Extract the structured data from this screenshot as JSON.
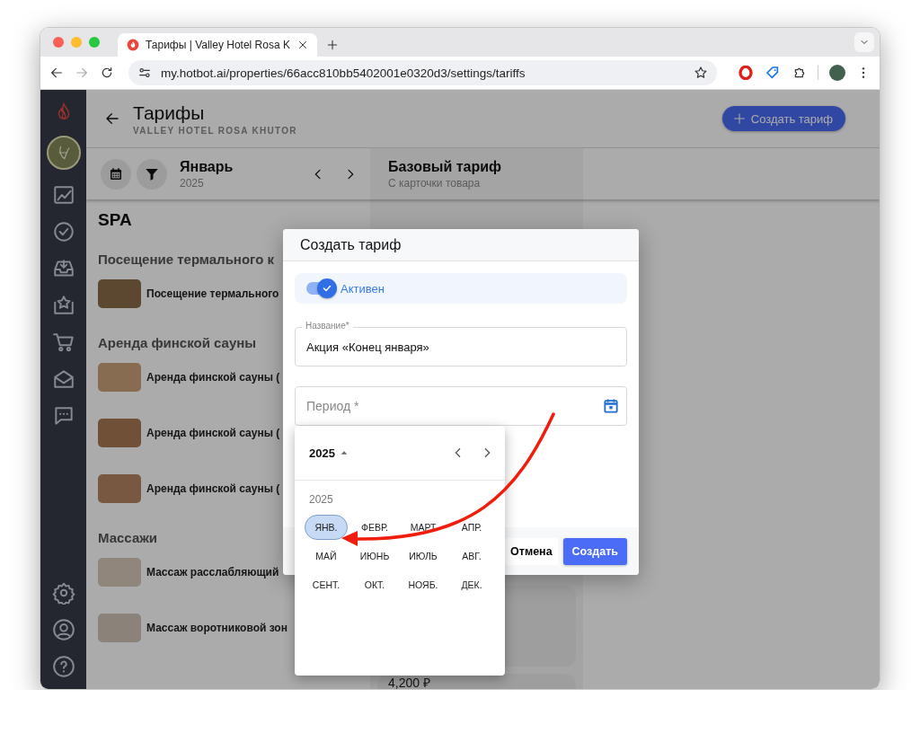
{
  "browser": {
    "tab": {
      "title": "Тарифы | Valley Hotel Rosa K",
      "selected": true
    },
    "url": "my.hotbot.ai/properties/66acc810bb5402001e0320d3/settings/tariffs"
  },
  "header": {
    "title": "Тарифы",
    "subtitle": "VALLEY HOTEL ROSA KHUTOR",
    "create_button": "Создать тариф"
  },
  "period": {
    "month": "Январь",
    "year": "2025"
  },
  "base_column": {
    "title": "Базовый тариф",
    "subtitle": "С карточки товара",
    "price": "4,200 ₽"
  },
  "catalog": {
    "title": "SPA",
    "groups": [
      {
        "title": "Посещение термального к",
        "items": [
          "Посещение термального"
        ]
      },
      {
        "title": "Аренда финской сауны",
        "items": [
          "Аренда финской сауны (",
          "Аренда финской сауны (",
          "Аренда финской сауны ("
        ]
      },
      {
        "title": "Массажи",
        "items": [
          "Массаж расслабляющий",
          "Массаж воротниковой зон"
        ]
      }
    ]
  },
  "dialog": {
    "title": "Создать тариф",
    "active": {
      "label": "Активен",
      "on": true
    },
    "name_field": {
      "label": "Название*",
      "value": "Акция «Конец января»"
    },
    "period_field": {
      "placeholder": "Период *"
    },
    "cancel_button": "Отмена",
    "submit_button": "Создать"
  },
  "month_picker": {
    "year_button": "2025",
    "year_label": "2025",
    "months": [
      {
        "label": "ЯНВ.",
        "selected": true
      },
      {
        "label": "ФЕВР.",
        "selected": false
      },
      {
        "label": "МАРТ",
        "selected": false
      },
      {
        "label": "АПР.",
        "selected": false
      },
      {
        "label": "МАЙ",
        "selected": false
      },
      {
        "label": "ИЮНЬ",
        "selected": false
      },
      {
        "label": "ИЮЛЬ",
        "selected": false
      },
      {
        "label": "АВГ.",
        "selected": false
      },
      {
        "label": "СЕНТ.",
        "selected": false
      },
      {
        "label": "ОКТ.",
        "selected": false
      },
      {
        "label": "НОЯБ.",
        "selected": false
      },
      {
        "label": "ДЕК.",
        "selected": false
      }
    ]
  }
}
